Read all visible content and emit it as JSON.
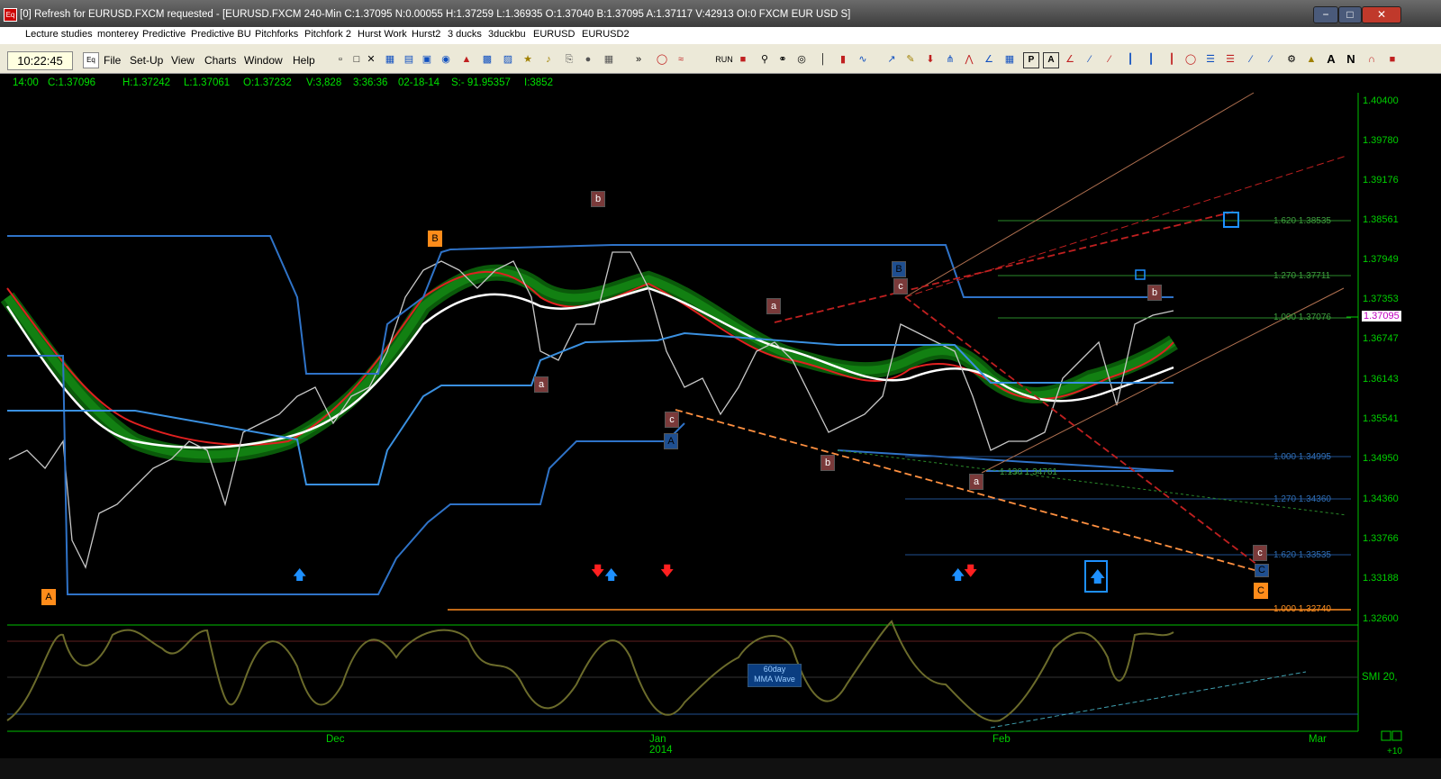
{
  "window": {
    "title": "[0] Refresh for EURUSD.FXCM requested - [EURUSD.FXCM 240-Min C:1.37095 N:0.00055 H:1.37259 L:1.36935 O:1.37040 B:1.37095 A:1.37117 V:42913 OI:0 FXCM EUR USD S]",
    "app_icon": "Eq",
    "minimize": "−",
    "restore": "□",
    "close": "✕"
  },
  "tabs": [
    "Lecture studies",
    "monterey",
    "Predictive",
    "Predictive BU",
    "Pitchforks",
    "Pitchfork 2",
    "Hurst Work",
    "Hurst2",
    "3 ducks",
    "3duckbu",
    "EURUSD",
    "EURUSD2"
  ],
  "toolbar": {
    "clock": "10:22:45",
    "app_icon": "Eq",
    "menu": [
      "File",
      "Set-Up",
      "View",
      "Charts",
      "Window",
      "Help"
    ],
    "run_label": "RUN"
  },
  "status": {
    "time": "14:00",
    "close": "C:1.37096",
    "high": "H:1.37242",
    "low": "L:1.37061",
    "open": "O:1.37232",
    "volume": "V:3,828",
    "clock": "3:36:36",
    "date": "02-18-14",
    "s": "S:- 91.95357",
    "i": "I:3852"
  },
  "price_axis": [
    "1.40400",
    "1.39780",
    "1.39176",
    "1.38561",
    "1.37949",
    "1.37353",
    "1.36747",
    "1.36143",
    "1.35541",
    "1.34950",
    "1.34360",
    "1.33766",
    "1.33188",
    "1.32600"
  ],
  "current_price": "1.37095",
  "date_axis": {
    "dec": "Dec",
    "jan": "Jan",
    "year": "2014",
    "feb": "Feb",
    "mar": "Mar"
  },
  "fib_levels": [
    {
      "label": "1.620  1.38535",
      "color": "#3ea03e"
    },
    {
      "label": "1.270  1.37711",
      "color": "#3ea03e"
    },
    {
      "label": "1.000  1.37076",
      "color": "#3ea03e"
    },
    {
      "label": "1.000  1.34995",
      "color": "#2f6fb8"
    },
    {
      "label": "1.270  1.34360",
      "color": "#2f6fb8"
    },
    {
      "label": "1.620  1.33535",
      "color": "#2f6fb8"
    },
    {
      "label": "1.000  1.32740",
      "color": "#ff9020"
    },
    {
      "label": "1.130  1.34761",
      "color": "#3ea03e"
    }
  ],
  "wave_labels": {
    "A": "A",
    "B": "B",
    "C": "C",
    "b_top": "b",
    "a1": "a",
    "c1": "c",
    "A_blue": "A",
    "a2": "a",
    "b2": "b",
    "B_blue": "B",
    "c2": "c",
    "a3": "a",
    "b3": "b",
    "c3": "c",
    "C_blue": "C"
  },
  "indicator": {
    "title_line1": "60day",
    "title_line2": "MMA Wave",
    "smi": "SMI  20,"
  },
  "corner": {
    "plus_ten": "+10"
  },
  "colors": {
    "up_arrow": "#1e90ff",
    "down_arrow": "#ff2020",
    "grid_text": "#00d000"
  }
}
